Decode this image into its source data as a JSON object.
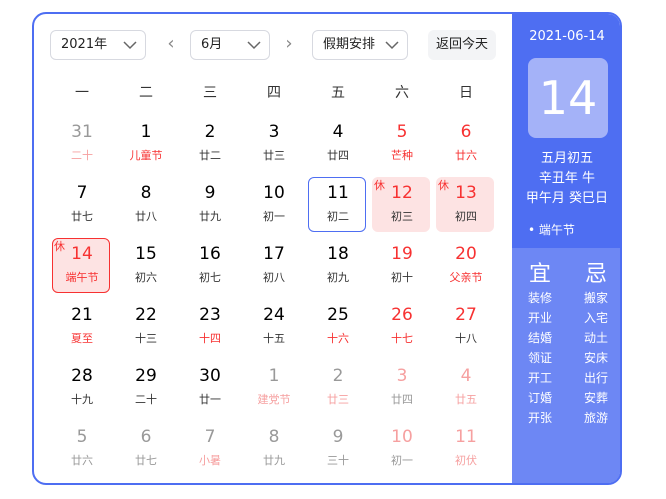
{
  "toolbar": {
    "year_value": "2021年",
    "month_value": "6月",
    "holiday_value": "假期安排",
    "prev_month": "‹",
    "next_month": "›",
    "today_button": "返回今天"
  },
  "weekdays": [
    "一",
    "二",
    "三",
    "四",
    "五",
    "六",
    "日"
  ],
  "weeks": [
    [
      {
        "d": "31",
        "l": "二十",
        "type": "other",
        "red_lunar": true
      },
      {
        "d": "1",
        "l": "儿童节",
        "red_lunar": true
      },
      {
        "d": "2",
        "l": "廿二"
      },
      {
        "d": "3",
        "l": "廿三"
      },
      {
        "d": "4",
        "l": "廿四"
      },
      {
        "d": "5",
        "l": "芒种",
        "weekend": true,
        "red_lunar": true
      },
      {
        "d": "6",
        "l": "廿六",
        "weekend": true,
        "red_lunar": true
      }
    ],
    [
      {
        "d": "7",
        "l": "廿七"
      },
      {
        "d": "8",
        "l": "廿八"
      },
      {
        "d": "9",
        "l": "廿九"
      },
      {
        "d": "10",
        "l": "初一"
      },
      {
        "d": "11",
        "l": "初二",
        "today": true
      },
      {
        "d": "12",
        "l": "初三",
        "holiday": true,
        "tag": "休"
      },
      {
        "d": "13",
        "l": "初四",
        "holiday": true,
        "tag": "休"
      }
    ],
    [
      {
        "d": "14",
        "l": "端午节",
        "selected": true,
        "tag": "休",
        "red_lunar": true
      },
      {
        "d": "15",
        "l": "初六"
      },
      {
        "d": "16",
        "l": "初七"
      },
      {
        "d": "17",
        "l": "初八"
      },
      {
        "d": "18",
        "l": "初九"
      },
      {
        "d": "19",
        "l": "初十",
        "weekend": true
      },
      {
        "d": "20",
        "l": "父亲节",
        "weekend": true,
        "red_lunar": true
      }
    ],
    [
      {
        "d": "21",
        "l": "夏至",
        "red_lunar": true
      },
      {
        "d": "22",
        "l": "十三"
      },
      {
        "d": "23",
        "l": "十四",
        "red_lunar": true
      },
      {
        "d": "24",
        "l": "十五"
      },
      {
        "d": "25",
        "l": "十六",
        "red_lunar": true
      },
      {
        "d": "26",
        "l": "十七",
        "weekend": true,
        "red_lunar": true
      },
      {
        "d": "27",
        "l": "十八",
        "weekend": true
      }
    ],
    [
      {
        "d": "28",
        "l": "十九"
      },
      {
        "d": "29",
        "l": "二十"
      },
      {
        "d": "30",
        "l": "廿一"
      },
      {
        "d": "1",
        "l": "建党节",
        "type": "other",
        "red_lunar": true
      },
      {
        "d": "2",
        "l": "廿三",
        "type": "other",
        "red_lunar": true
      },
      {
        "d": "3",
        "l": "廿四",
        "type": "other",
        "weekend": true
      },
      {
        "d": "4",
        "l": "廿五",
        "type": "other",
        "weekend": true,
        "red_lunar": true
      }
    ],
    [
      {
        "d": "5",
        "l": "廿六",
        "type": "other"
      },
      {
        "d": "6",
        "l": "廿七",
        "type": "other"
      },
      {
        "d": "7",
        "l": "小暑",
        "type": "other",
        "red_lunar": true
      },
      {
        "d": "8",
        "l": "廿九",
        "type": "other"
      },
      {
        "d": "9",
        "l": "三十",
        "type": "other"
      },
      {
        "d": "10",
        "l": "初一",
        "type": "other",
        "weekend": true
      },
      {
        "d": "11",
        "l": "初伏",
        "type": "other",
        "weekend": true,
        "red_lunar": true
      }
    ]
  ],
  "side": {
    "date": "2021-06-14",
    "day": "14",
    "lunar_date": "五月初五",
    "year_gz": "辛丑年 牛",
    "month_day_gz": "甲午月 癸巳日",
    "festival": "• 端午节",
    "yi_title": "宜",
    "ji_title": "忌",
    "yi": [
      "装修",
      "开业",
      "结婚",
      "领证",
      "开工",
      "订婚",
      "开张"
    ],
    "ji": [
      "搬家",
      "入宅",
      "动土",
      "安床",
      "出行",
      "安葬",
      "旅游"
    ]
  },
  "colors": {
    "accent": "#4e6ef2",
    "red": "#f73131",
    "holiday_bg": "#fde3e3",
    "side_lower": "#6d87f4"
  }
}
